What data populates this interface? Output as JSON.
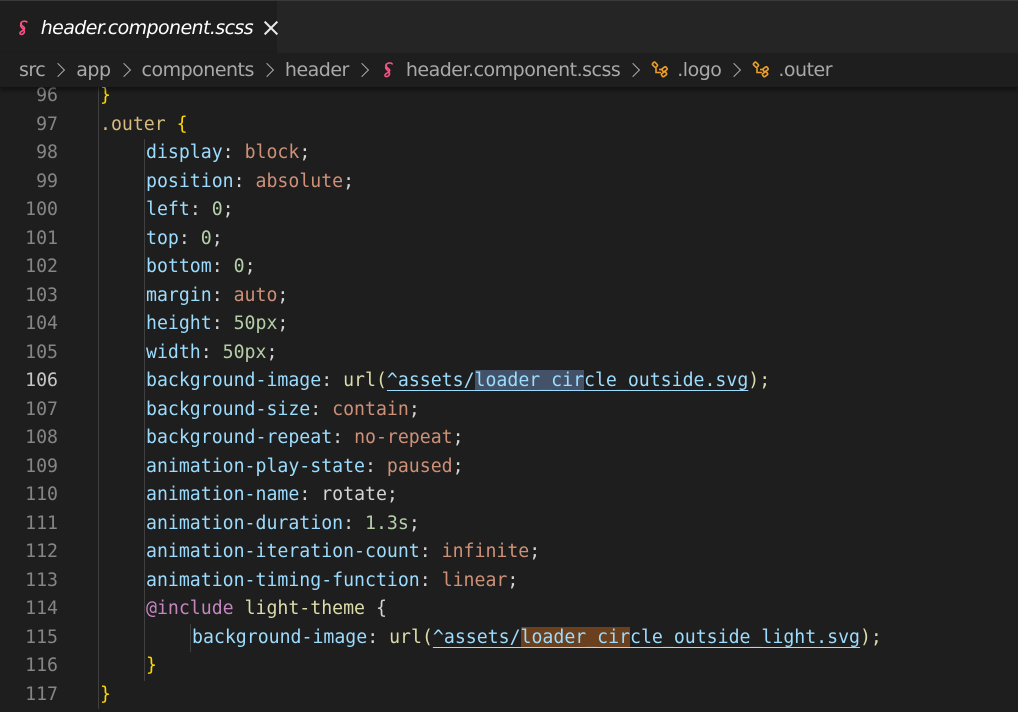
{
  "tab": {
    "label": "header.component.scss",
    "icon": "sass-icon",
    "close_icon": "close-icon"
  },
  "breadcrumb": {
    "items": [
      {
        "label": "src",
        "icon": null
      },
      {
        "label": "app",
        "icon": null
      },
      {
        "label": "components",
        "icon": null
      },
      {
        "label": "header",
        "icon": null
      },
      {
        "label": "header.component.scss",
        "icon": "sass-icon"
      },
      {
        "label": ".logo",
        "icon": "css-selector-icon"
      },
      {
        "label": ".outer",
        "icon": "css-selector-icon"
      }
    ]
  },
  "editor": {
    "active_line": 106,
    "colors": {
      "background": "#1e1e1e",
      "property": "#9cdcfe",
      "value": "#ce9178",
      "number": "#b5cea8",
      "selector": "#d7ba7d",
      "at_rule": "#c586c0",
      "sass_icon": "#f55385",
      "selector_icon": "#ee9d28"
    },
    "lines": [
      {
        "n": "96",
        "indent": 1,
        "tokens": [
          {
            "t": "}",
            "c": "brace-y"
          }
        ]
      },
      {
        "n": "97",
        "indent": 1,
        "tokens": [
          {
            "t": ".outer",
            "c": "sel"
          },
          {
            "t": " ",
            "c": "plain"
          },
          {
            "t": "{",
            "c": "brace-y"
          }
        ]
      },
      {
        "n": "98",
        "indent": 2,
        "tokens": [
          {
            "t": "display",
            "c": "prop"
          },
          {
            "t": ": ",
            "c": "punc"
          },
          {
            "t": "block",
            "c": "val"
          },
          {
            "t": ";",
            "c": "punc"
          }
        ]
      },
      {
        "n": "99",
        "indent": 2,
        "tokens": [
          {
            "t": "position",
            "c": "prop"
          },
          {
            "t": ": ",
            "c": "punc"
          },
          {
            "t": "absolute",
            "c": "val"
          },
          {
            "t": ";",
            "c": "punc"
          }
        ]
      },
      {
        "n": "100",
        "indent": 2,
        "tokens": [
          {
            "t": "left",
            "c": "prop"
          },
          {
            "t": ": ",
            "c": "punc"
          },
          {
            "t": "0",
            "c": "num"
          },
          {
            "t": ";",
            "c": "punc"
          }
        ]
      },
      {
        "n": "101",
        "indent": 2,
        "tokens": [
          {
            "t": "top",
            "c": "prop"
          },
          {
            "t": ": ",
            "c": "punc"
          },
          {
            "t": "0",
            "c": "num"
          },
          {
            "t": ";",
            "c": "punc"
          }
        ]
      },
      {
        "n": "102",
        "indent": 2,
        "tokens": [
          {
            "t": "bottom",
            "c": "prop"
          },
          {
            "t": ": ",
            "c": "punc"
          },
          {
            "t": "0",
            "c": "num"
          },
          {
            "t": ";",
            "c": "punc"
          }
        ]
      },
      {
        "n": "103",
        "indent": 2,
        "tokens": [
          {
            "t": "margin",
            "c": "prop"
          },
          {
            "t": ": ",
            "c": "punc"
          },
          {
            "t": "auto",
            "c": "val"
          },
          {
            "t": ";",
            "c": "punc"
          }
        ]
      },
      {
        "n": "104",
        "indent": 2,
        "tokens": [
          {
            "t": "height",
            "c": "prop"
          },
          {
            "t": ": ",
            "c": "punc"
          },
          {
            "t": "50px",
            "c": "num"
          },
          {
            "t": ";",
            "c": "punc"
          }
        ]
      },
      {
        "n": "105",
        "indent": 2,
        "tokens": [
          {
            "t": "width",
            "c": "prop"
          },
          {
            "t": ": ",
            "c": "punc"
          },
          {
            "t": "50px",
            "c": "num"
          },
          {
            "t": ";",
            "c": "punc"
          }
        ]
      },
      {
        "n": "106",
        "indent": 2,
        "tokens": [
          {
            "t": "background-image",
            "c": "prop"
          },
          {
            "t": ": ",
            "c": "punc"
          },
          {
            "t": "url(",
            "c": "mixin"
          },
          {
            "t": "^assets/",
            "c": "link"
          },
          {
            "t": "loader_cir",
            "c": "link hl-sel"
          },
          {
            "t": "cle_outside.svg",
            "c": "link"
          },
          {
            "t": ");",
            "c": "mixin"
          }
        ]
      },
      {
        "n": "107",
        "indent": 2,
        "tokens": [
          {
            "t": "background-size",
            "c": "prop"
          },
          {
            "t": ": ",
            "c": "punc"
          },
          {
            "t": "contain",
            "c": "val"
          },
          {
            "t": ";",
            "c": "punc"
          }
        ]
      },
      {
        "n": "108",
        "indent": 2,
        "tokens": [
          {
            "t": "background-repeat",
            "c": "prop"
          },
          {
            "t": ": ",
            "c": "punc"
          },
          {
            "t": "no-repeat",
            "c": "val"
          },
          {
            "t": ";",
            "c": "punc"
          }
        ]
      },
      {
        "n": "109",
        "indent": 2,
        "tokens": [
          {
            "t": "animation-play-state",
            "c": "prop"
          },
          {
            "t": ": ",
            "c": "punc"
          },
          {
            "t": "paused",
            "c": "val"
          },
          {
            "t": ";",
            "c": "punc"
          }
        ]
      },
      {
        "n": "110",
        "indent": 2,
        "tokens": [
          {
            "t": "animation-name",
            "c": "prop"
          },
          {
            "t": ": ",
            "c": "punc"
          },
          {
            "t": "rotate",
            "c": "plain"
          },
          {
            "t": ";",
            "c": "punc"
          }
        ]
      },
      {
        "n": "111",
        "indent": 2,
        "tokens": [
          {
            "t": "animation-duration",
            "c": "prop"
          },
          {
            "t": ": ",
            "c": "punc"
          },
          {
            "t": "1.3s",
            "c": "num"
          },
          {
            "t": ";",
            "c": "punc"
          }
        ]
      },
      {
        "n": "112",
        "indent": 2,
        "tokens": [
          {
            "t": "animation-iteration-count",
            "c": "prop"
          },
          {
            "t": ": ",
            "c": "punc"
          },
          {
            "t": "infinite",
            "c": "val"
          },
          {
            "t": ";",
            "c": "punc"
          }
        ]
      },
      {
        "n": "113",
        "indent": 2,
        "tokens": [
          {
            "t": "animation-timing-function",
            "c": "prop"
          },
          {
            "t": ": ",
            "c": "punc"
          },
          {
            "t": "linear",
            "c": "val"
          },
          {
            "t": ";",
            "c": "punc"
          }
        ]
      },
      {
        "n": "114",
        "indent": 2,
        "tokens": [
          {
            "t": "@include",
            "c": "at"
          },
          {
            "t": " ",
            "c": "plain"
          },
          {
            "t": "light-theme",
            "c": "mixin"
          },
          {
            "t": " ",
            "c": "plain"
          },
          {
            "t": "{",
            "c": "punc"
          }
        ]
      },
      {
        "n": "115",
        "indent": 3,
        "tokens": [
          {
            "t": "background-image",
            "c": "prop"
          },
          {
            "t": ": ",
            "c": "punc"
          },
          {
            "t": "url(",
            "c": "mixin"
          },
          {
            "t": "^assets/",
            "c": "link"
          },
          {
            "t": "loader_cir",
            "c": "link hl-find"
          },
          {
            "t": "cle_outside_light.svg",
            "c": "link"
          },
          {
            "t": ");",
            "c": "mixin"
          }
        ]
      },
      {
        "n": "116",
        "indent": 2,
        "tokens": [
          {
            "t": "}",
            "c": "brace-y"
          }
        ]
      },
      {
        "n": "117",
        "indent": 1,
        "tokens": [
          {
            "t": "}",
            "c": "brace-y"
          }
        ]
      }
    ]
  }
}
